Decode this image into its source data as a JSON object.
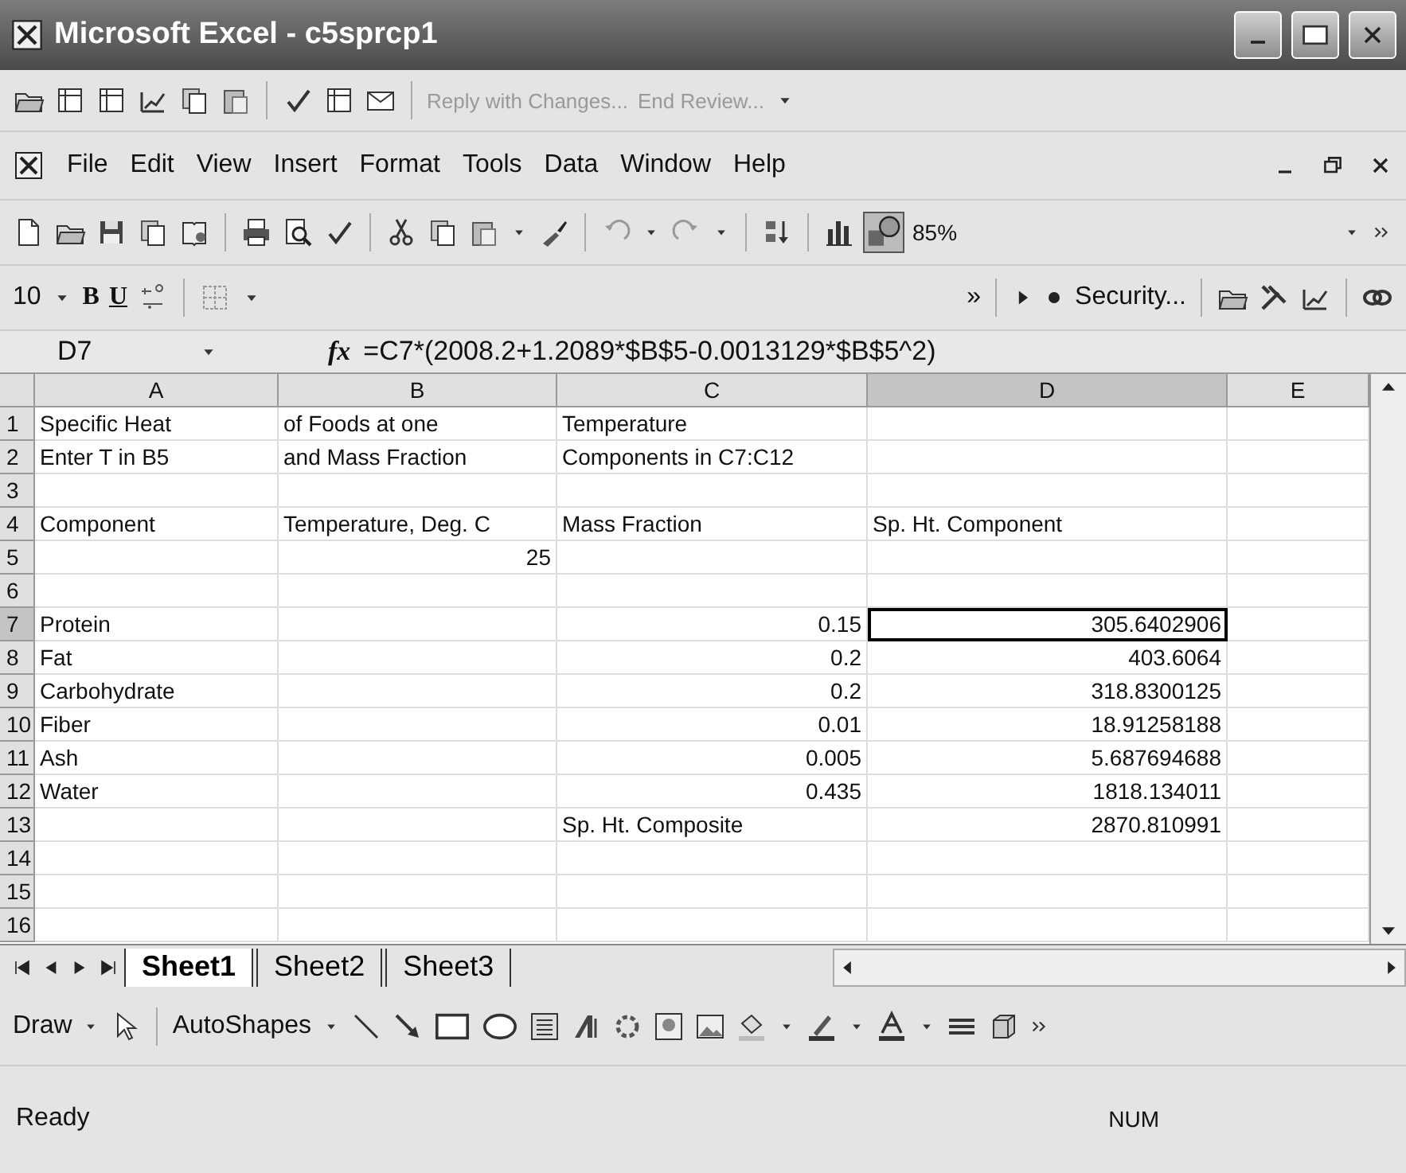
{
  "window": {
    "title": "Microsoft Excel - c5sprcp1"
  },
  "reviewing_toolbar": {
    "reply_button": "Reply with Changes...",
    "end_button": "End Review...",
    "disabled": true
  },
  "menu": {
    "items": [
      "File",
      "Edit",
      "View",
      "Insert",
      "Format",
      "Tools",
      "Data",
      "Window",
      "Help"
    ]
  },
  "standard_toolbar": {
    "zoom": "85%",
    "drawing_pressed": true
  },
  "formatting_toolbar": {
    "font_size": "10",
    "bold": "B",
    "underline": "U",
    "overflow": "»",
    "security": "Security..."
  },
  "formula_bar": {
    "name_box": "D7",
    "fx": "fx",
    "formula": "=C7*(2008.2+1.2089*$B$5-0.0013129*$B$5^2)"
  },
  "columns": [
    {
      "label": "A",
      "selected": false
    },
    {
      "label": "B",
      "selected": false
    },
    {
      "label": "C",
      "selected": false
    },
    {
      "label": "D",
      "selected": true
    },
    {
      "label": "E",
      "selected": false
    }
  ],
  "rows": [
    {
      "number": "1",
      "selected": false,
      "a": {
        "kind": "text",
        "text": "Specific Heat",
        "selected": false
      },
      "b": {
        "kind": "text",
        "text": "of Foods at one",
        "selected": false
      },
      "c": {
        "kind": "text",
        "text": "Temperature",
        "selected": false
      }
    },
    {
      "number": "2",
      "selected": false,
      "a": {
        "kind": "text",
        "text": "Enter T in B5",
        "selected": false
      },
      "b": {
        "kind": "text",
        "text": "and Mass Fraction",
        "selected": false
      },
      "c": {
        "kind": "text",
        "text": "Components in C7:C12",
        "selected": false
      }
    },
    {
      "number": "3",
      "selected": false
    },
    {
      "number": "4",
      "selected": false,
      "a": {
        "kind": "text",
        "text": "Component",
        "selected": false
      },
      "b": {
        "kind": "text",
        "text": "Temperature, Deg. C",
        "selected": false
      },
      "c": {
        "kind": "text",
        "text": "Mass Fraction",
        "selected": false
      },
      "d": {
        "kind": "text",
        "text": "Sp. Ht. Component",
        "selected": false
      }
    },
    {
      "number": "5",
      "selected": false,
      "b": {
        "kind": "number",
        "text": "25",
        "selected": false
      }
    },
    {
      "number": "6",
      "selected": false
    },
    {
      "number": "7",
      "selected": true,
      "a": {
        "kind": "text",
        "text": "Protein",
        "selected": false
      },
      "c": {
        "kind": "number",
        "text": "0.15",
        "selected": false
      },
      "d": {
        "kind": "number",
        "text": "305.6402906",
        "selected": true
      }
    },
    {
      "number": "8",
      "selected": false,
      "a": {
        "kind": "text",
        "text": "Fat",
        "selected": false
      },
      "c": {
        "kind": "number",
        "text": "0.2",
        "selected": false
      },
      "d": {
        "kind": "number",
        "text": "403.6064",
        "selected": false
      }
    },
    {
      "number": "9",
      "selected": false,
      "a": {
        "kind": "text",
        "text": "Carbohydrate",
        "selected": false
      },
      "c": {
        "kind": "number",
        "text": "0.2",
        "selected": false
      },
      "d": {
        "kind": "number",
        "text": "318.8300125",
        "selected": false
      }
    },
    {
      "number": "10",
      "selected": false,
      "a": {
        "kind": "text",
        "text": "Fiber",
        "selected": false
      },
      "c": {
        "kind": "number",
        "text": "0.01",
        "selected": false
      },
      "d": {
        "kind": "number",
        "text": "18.91258188",
        "selected": false
      }
    },
    {
      "number": "11",
      "selected": false,
      "a": {
        "kind": "text",
        "text": "Ash",
        "selected": false
      },
      "c": {
        "kind": "number",
        "text": "0.005",
        "selected": false
      },
      "d": {
        "kind": "number",
        "text": "5.687694688",
        "selected": false
      }
    },
    {
      "number": "12",
      "selected": false,
      "a": {
        "kind": "text",
        "text": "Water",
        "selected": false
      },
      "c": {
        "kind": "number",
        "text": "0.435",
        "selected": false
      },
      "d": {
        "kind": "number",
        "text": "1818.134011",
        "selected": false
      }
    },
    {
      "number": "13",
      "selected": false,
      "c": {
        "kind": "text",
        "text": "Sp. Ht. Composite",
        "selected": false
      },
      "d": {
        "kind": "number",
        "text": "2870.810991",
        "selected": false
      }
    },
    {
      "number": "14",
      "selected": false
    },
    {
      "number": "15",
      "selected": false
    },
    {
      "number": "16",
      "selected": false
    }
  ],
  "sheet_tabs": [
    {
      "label": "Sheet1",
      "selected": true
    },
    {
      "label": "Sheet2",
      "selected": false
    },
    {
      "label": "Sheet3",
      "selected": false
    }
  ],
  "drawing_toolbar": {
    "draw": "Draw",
    "autoshapes": "AutoShapes"
  },
  "status_bar": {
    "status": "Ready",
    "num": "NUM"
  }
}
